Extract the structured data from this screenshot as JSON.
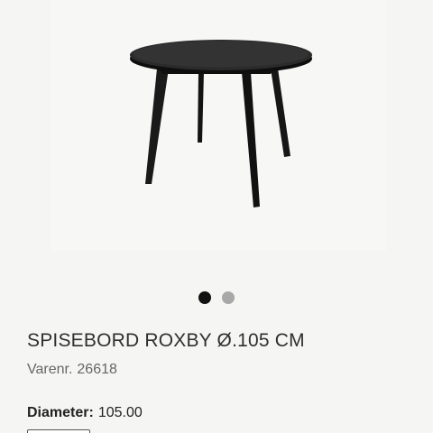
{
  "product": {
    "title": "SPISEBORD ROXBY Ø.105 CM",
    "item_number_label": "Varenr.",
    "item_number": "26618",
    "specs": [
      {
        "label": "Diameter:",
        "value": "105.00"
      }
    ]
  },
  "gallery": {
    "image": "dining-table-product-image",
    "dots": [
      {
        "active": true,
        "color": "#111111"
      },
      {
        "active": false,
        "color": "#a8a8a8"
      }
    ]
  },
  "colors": {
    "background": "#f5f5f3",
    "table": "#1e1e1e"
  }
}
